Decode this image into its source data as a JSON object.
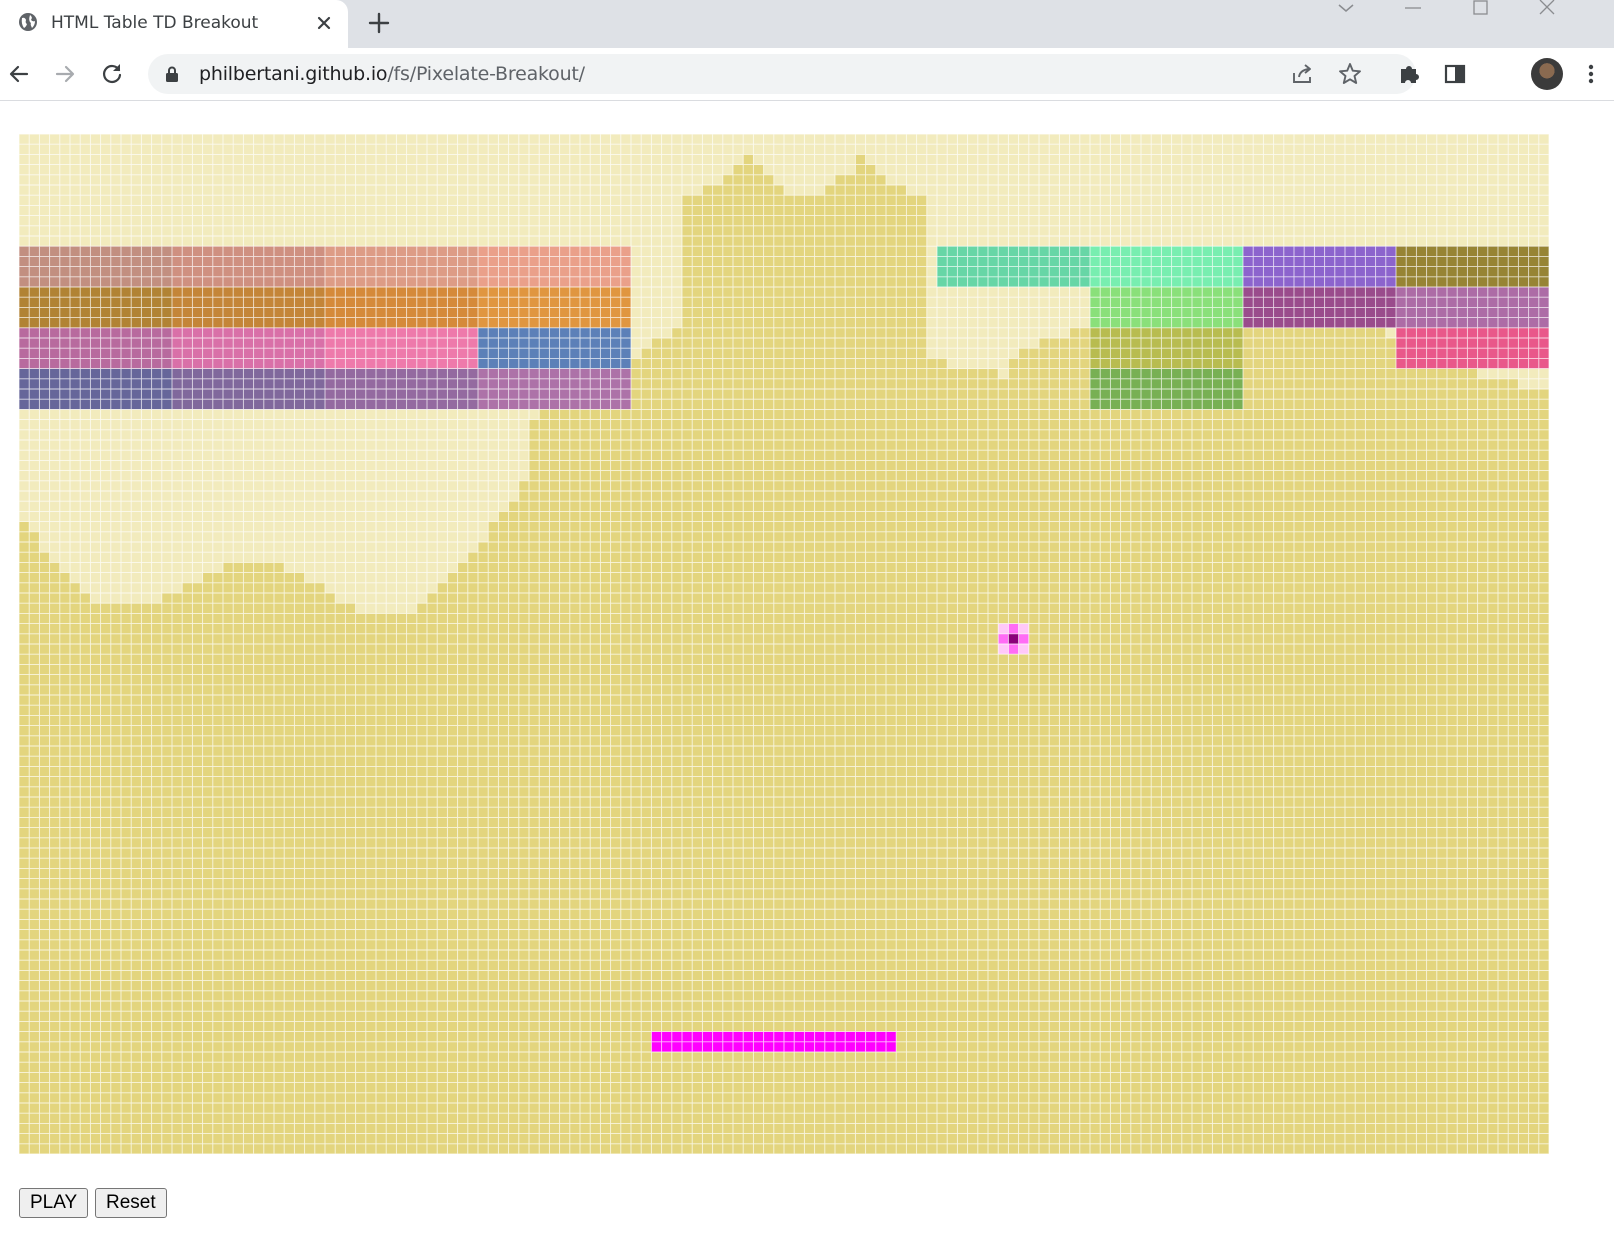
{
  "browser": {
    "tab_title": "HTML Table TD Breakout",
    "url_host": "philbertani.github.io",
    "url_path": "/fs/Pixelate-Breakout/"
  },
  "game": {
    "grid": {
      "cols": 150,
      "rows": 100
    },
    "colors": {
      "cell_light": "#f2ebbd",
      "cell_dark": "#e3d57e",
      "grid_line": "#ffffff",
      "paddle": "#ff00ff",
      "ball_core": "#8a007a",
      "ball_outer": "#ff6cf5"
    },
    "bricks": [
      {
        "row": 0,
        "col": 0,
        "color": "#c28f80"
      },
      {
        "row": 0,
        "col": 1,
        "color": "#cf9080"
      },
      {
        "row": 0,
        "col": 2,
        "color": "#dd9c86"
      },
      {
        "row": 0,
        "col": 3,
        "color": "#eaa08a"
      },
      {
        "row": 0,
        "col": 6,
        "color": "#67d6a6"
      },
      {
        "row": 0,
        "col": 7,
        "color": "#78eeb0"
      },
      {
        "row": 0,
        "col": 8,
        "color": "#8c64cd"
      },
      {
        "row": 0,
        "col": 9,
        "color": "#978434"
      },
      {
        "row": 1,
        "col": 0,
        "color": "#b18334"
      },
      {
        "row": 1,
        "col": 1,
        "color": "#c48538"
      },
      {
        "row": 1,
        "col": 2,
        "color": "#d58a3a"
      },
      {
        "row": 1,
        "col": 3,
        "color": "#e09640"
      },
      {
        "row": 1,
        "col": 7,
        "color": "#8ae07a"
      },
      {
        "row": 1,
        "col": 8,
        "color": "#9a4c8c"
      },
      {
        "row": 1,
        "col": 9,
        "color": "#ad6ca6"
      },
      {
        "row": 2,
        "col": 0,
        "color": "#b86a9e"
      },
      {
        "row": 2,
        "col": 1,
        "color": "#d970a8"
      },
      {
        "row": 2,
        "col": 2,
        "color": "#ee7aab"
      },
      {
        "row": 2,
        "col": 3,
        "color": "#5c80b8"
      },
      {
        "row": 2,
        "col": 7,
        "color": "#b8bc50"
      },
      {
        "row": 2,
        "col": 9,
        "color": "#e9588a"
      },
      {
        "row": 3,
        "col": 0,
        "color": "#66669a"
      },
      {
        "row": 3,
        "col": 1,
        "color": "#80689c"
      },
      {
        "row": 3,
        "col": 2,
        "color": "#946aa0"
      },
      {
        "row": 3,
        "col": 3,
        "color": "#ad72a8"
      },
      {
        "row": 3,
        "col": 7,
        "color": "#78b054"
      }
    ],
    "paddle": {
      "col_start": 62,
      "col_end": 86,
      "row_start": 88,
      "row_end": 90
    },
    "ball": {
      "col": 97,
      "row": 49
    },
    "buttons": {
      "play": "PLAY",
      "reset": "Reset"
    }
  }
}
